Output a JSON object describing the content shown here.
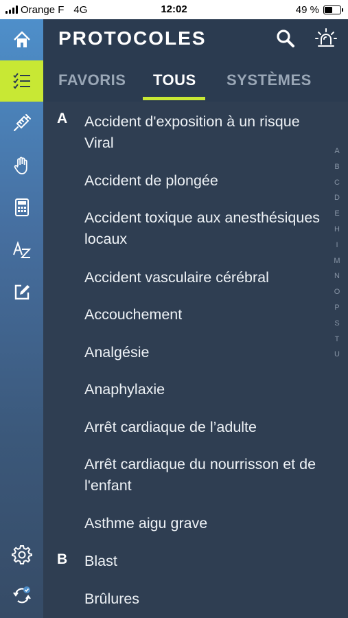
{
  "status_bar": {
    "carrier": "Orange F",
    "network": "4G",
    "time": "12:02",
    "battery_text": "49 %",
    "battery_level": 0.49
  },
  "sidebar": {
    "items": [
      {
        "icon": "home-icon"
      },
      {
        "icon": "checklist-icon",
        "active": true
      },
      {
        "icon": "syringe-icon"
      },
      {
        "icon": "hand-icon"
      },
      {
        "icon": "calculator-icon"
      },
      {
        "icon": "az-icon"
      },
      {
        "icon": "edit-icon"
      },
      {
        "icon": "gear-icon"
      },
      {
        "icon": "sync-icon"
      }
    ]
  },
  "header": {
    "title": "PROTOCOLES",
    "search_icon": "search-icon",
    "alert_icon": "siren-icon",
    "tabs": [
      {
        "label": "FAVORIS"
      },
      {
        "label": "TOUS",
        "active": true
      },
      {
        "label": "SYSTÈMES"
      }
    ]
  },
  "list": {
    "sections": [
      {
        "letter": "A",
        "items": [
          "Accident d'exposition à un risque Viral",
          "Accident de plongée",
          "Accident toxique aux anesthésiques locaux",
          "Accident vasculaire cérébral",
          "Accouchement",
          "Analgésie",
          "Anaphylaxie",
          "Arrêt cardiaque de l’adulte",
          "Arrêt cardiaque du nourrisson et de l'enfant",
          "Asthme aigu grave"
        ]
      },
      {
        "letter": "B",
        "items": [
          "Blast",
          "Brûlures"
        ]
      }
    ]
  },
  "alpha_index": [
    "A",
    "B",
    "C",
    "D",
    "E",
    "H",
    "I",
    "M",
    "N",
    "O",
    "P",
    "S",
    "T",
    "U"
  ],
  "colors": {
    "accent": "#c8e834",
    "background": "#2f3e52",
    "sidebar_top": "#4e8fca",
    "inactive_tab": "#9aa7b6"
  }
}
